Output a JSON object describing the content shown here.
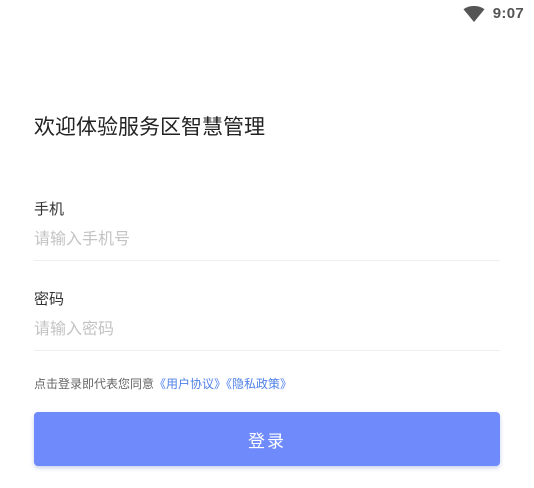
{
  "status_bar": {
    "time": "9:07",
    "wifi_icon": "wifi-icon"
  },
  "title": "欢迎体验服务区智慧管理",
  "phone": {
    "label": "手机",
    "placeholder": "请输入手机号"
  },
  "password": {
    "label": "密码",
    "placeholder": "请输入密码"
  },
  "agreement": {
    "prefix": "点击登录即代表您同意",
    "user_agreement": "《用户协议》",
    "privacy_policy": "《隐私政策》"
  },
  "login_button": "登录",
  "colors": {
    "primary": "#6f8bfb",
    "link": "#4f80e8",
    "placeholder": "#c3c3c3"
  }
}
